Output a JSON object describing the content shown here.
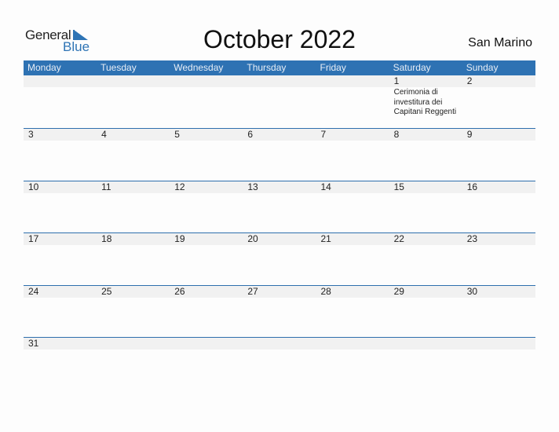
{
  "logo": {
    "line1": "General",
    "line2": "Blue"
  },
  "title": "October 2022",
  "country": "San Marino",
  "colors": {
    "accent": "#2e72b3",
    "day_strip": "#f1f1f1"
  },
  "weekdays": [
    "Monday",
    "Tuesday",
    "Wednesday",
    "Thursday",
    "Friday",
    "Saturday",
    "Sunday"
  ],
  "weeks": [
    [
      {
        "d": ""
      },
      {
        "d": ""
      },
      {
        "d": ""
      },
      {
        "d": ""
      },
      {
        "d": ""
      },
      {
        "d": "1",
        "event": "Cerimonia di investitura dei Capitani Reggenti"
      },
      {
        "d": "2"
      }
    ],
    [
      {
        "d": "3"
      },
      {
        "d": "4"
      },
      {
        "d": "5"
      },
      {
        "d": "6"
      },
      {
        "d": "7"
      },
      {
        "d": "8"
      },
      {
        "d": "9"
      }
    ],
    [
      {
        "d": "10"
      },
      {
        "d": "11"
      },
      {
        "d": "12"
      },
      {
        "d": "13"
      },
      {
        "d": "14"
      },
      {
        "d": "15"
      },
      {
        "d": "16"
      }
    ],
    [
      {
        "d": "17"
      },
      {
        "d": "18"
      },
      {
        "d": "19"
      },
      {
        "d": "20"
      },
      {
        "d": "21"
      },
      {
        "d": "22"
      },
      {
        "d": "23"
      }
    ],
    [
      {
        "d": "24"
      },
      {
        "d": "25"
      },
      {
        "d": "26"
      },
      {
        "d": "27"
      },
      {
        "d": "28"
      },
      {
        "d": "29"
      },
      {
        "d": "30"
      }
    ],
    [
      {
        "d": "31"
      },
      {
        "d": ""
      },
      {
        "d": ""
      },
      {
        "d": ""
      },
      {
        "d": ""
      },
      {
        "d": ""
      },
      {
        "d": ""
      }
    ]
  ]
}
